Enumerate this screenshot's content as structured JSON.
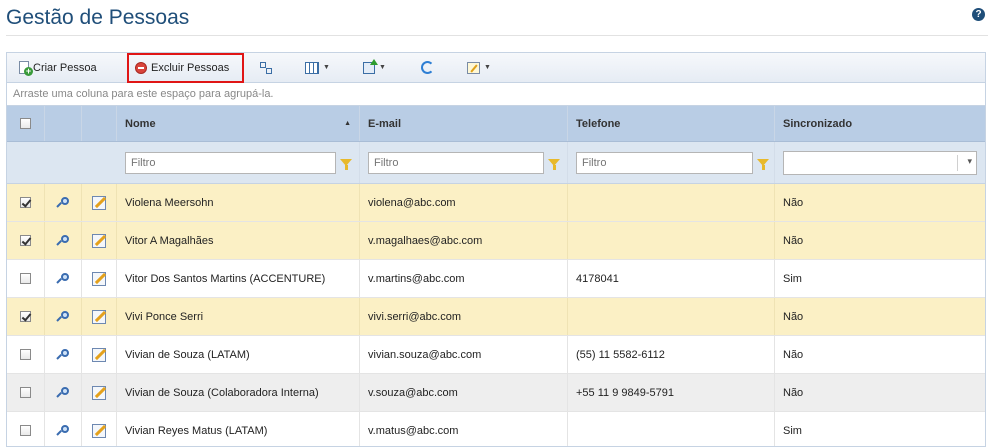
{
  "page": {
    "title": "Gestão de Pessoas",
    "help": "?"
  },
  "toolbar": {
    "create_label": "Criar Pessoa",
    "delete_label": "Excluir Pessoas",
    "caret": "▼"
  },
  "groupbar": {
    "text": "Arraste uma coluna para este espaço para agrupá-la."
  },
  "columns": {
    "name": "Nome",
    "email": "E-mail",
    "phone": "Telefone",
    "synced": "Sincronizado",
    "sort_indicator": "▲"
  },
  "filters": {
    "placeholder": "Filtro"
  },
  "rows": [
    {
      "checked": true,
      "name": "Violena Meersohn",
      "email": "violena@abc.com",
      "phone": "",
      "synced": "Não"
    },
    {
      "checked": true,
      "name": "Vitor A Magalhães",
      "email": "v.magalhaes@abc.com",
      "phone": "",
      "synced": "Não"
    },
    {
      "checked": false,
      "name": "Vitor Dos Santos Martins (ACCENTURE)",
      "email": "v.martins@abc.com",
      "phone": "4178041",
      "synced": "Sim"
    },
    {
      "checked": true,
      "name": "Vivi Ponce Serri",
      "email": "vivi.serri@abc.com",
      "phone": "",
      "synced": "Não"
    },
    {
      "checked": false,
      "name": "Vivian de Souza (LATAM)",
      "email": "vivian.souza@abc.com",
      "phone": "(55) 11 5582-6112",
      "synced": "Não"
    },
    {
      "checked": false,
      "name": "Vivian de Souza (Colaboradora Interna)",
      "email": "v.souza@abc.com",
      "phone": "+55 11 9 9849-5791",
      "synced": "Não"
    },
    {
      "checked": false,
      "name": "Vivian Reyes Matus (LATAM)",
      "email": "v.matus@abc.com",
      "phone": "",
      "synced": "Sim"
    }
  ],
  "colors": {
    "title": "#1f4e79",
    "header_bg": "#b9cde5",
    "selected_row": "#fbf0c5",
    "highlight_box": "#e01515"
  }
}
